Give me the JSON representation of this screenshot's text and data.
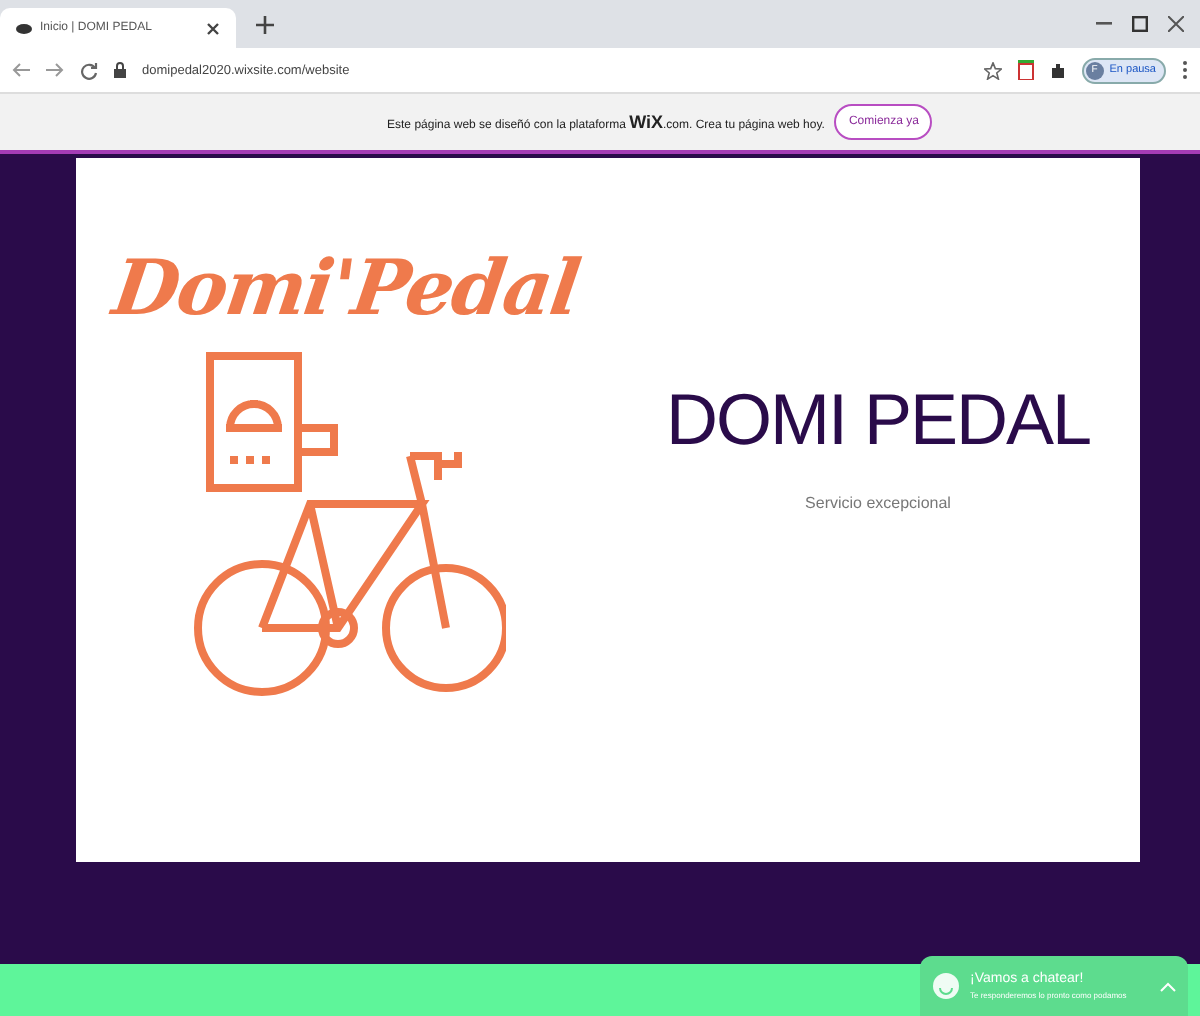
{
  "browser": {
    "tab_title": "Inicio | DOMI PEDAL",
    "url": "domipedal2020.wixsite.com/website",
    "profile_label": "En pausa",
    "profile_initial": "F"
  },
  "wix_banner": {
    "text_before": "Este página web se diseñó con la plataforma",
    "brand": "WiX",
    "text_after": ".com. Crea tu página web hoy.",
    "button": "Comienza ya"
  },
  "hero": {
    "logo_text": "Domi'Pedal",
    "title": "DOMI PEDAL",
    "subtitle": "Servicio excepcional"
  },
  "chat": {
    "title": "¡Vamos a chatear!",
    "subtitle": "Te responderemos lo pronto como podamos",
    "expanded": false
  }
}
